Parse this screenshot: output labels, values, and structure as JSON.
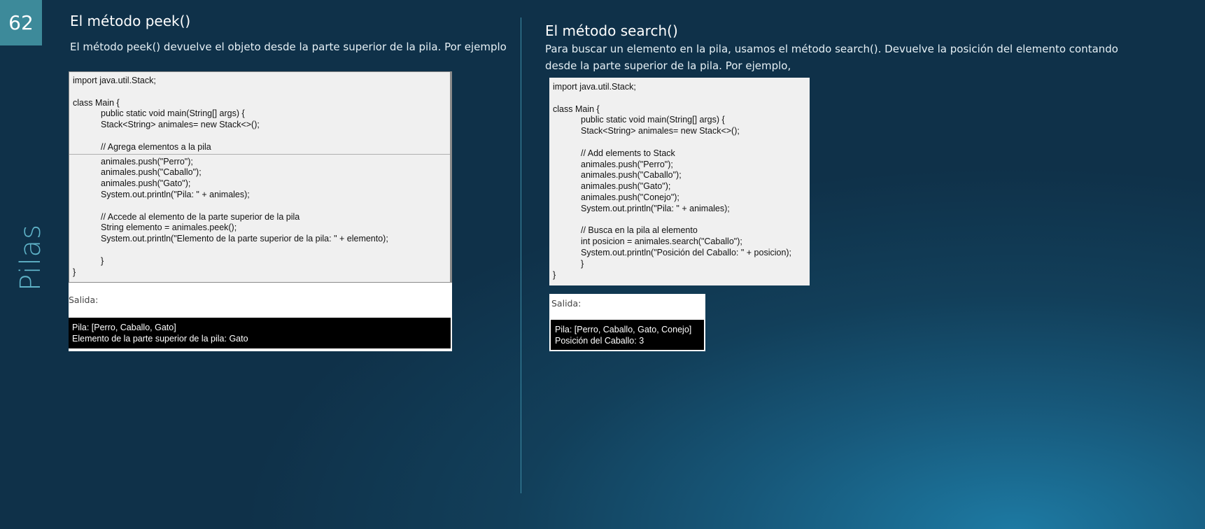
{
  "slide": {
    "number": "62",
    "side_title": "Pilas"
  },
  "left": {
    "heading": "El método peek()",
    "description": [
      "El método peek() devuelve el objeto desde la parte superior de la pila. Por ejemplo"
    ],
    "code": [
      "import java.util.Stack;",
      "",
      "class Main {",
      "public static void main(String[] args) {",
      "Stack<String> animales= new Stack<>();",
      "",
      "// Agrega elementos a la pila",
      "animales.push(\"Perro\");",
      "animales.push(\"Caballo\");",
      "animales.push(\"Gato\");",
      "System.out.println(\"Pila: \" + animales);",
      "",
      "// Accede al elemento de la parte superior de la pila",
      "String elemento = animales.peek();",
      "System.out.println(\"Elemento de la parte superior de la pila: \" + elemento);",
      "",
      "}",
      "}"
    ],
    "output_label": "Salida:",
    "output": [
      "Pila: [Perro, Caballo, Gato]",
      "Elemento de la parte superior de la pila: Gato"
    ]
  },
  "right": {
    "heading": "El método search()",
    "description": [
      "Para buscar un elemento en la pila, usamos el método search(). Devuelve la posición del elemento contando",
      "desde la parte superior de la pila. Por ejemplo,"
    ],
    "code": [
      "import java.util.Stack;",
      "",
      "class Main {",
      "public static void main(String[] args) {",
      "Stack<String> animales= new Stack<>();",
      "",
      "// Add elements to Stack",
      "animales.push(\"Perro\");",
      "animales.push(\"Caballo\");",
      "animales.push(\"Gato\");",
      "animales.push(\"Conejo\");",
      "System.out.println(\"Pila: \" + animales);",
      "",
      "// Busca en la pila al elemento",
      "int posicion = animales.search(\"Caballo\");",
      "System.out.println(\"Posición del Caballo: \" + posicion);",
      "}",
      "}"
    ],
    "output_label": "Salida:",
    "output": [
      "Pila: [Perro, Caballo, Gato, Conejo]",
      "Posición del Caballo: 3"
    ]
  }
}
